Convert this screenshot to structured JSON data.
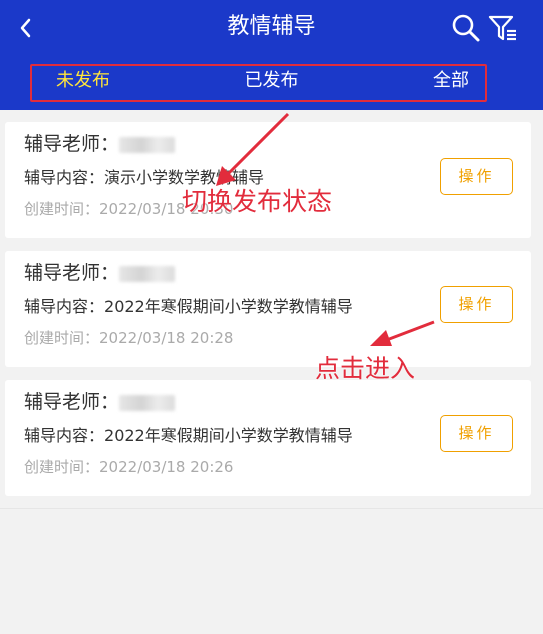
{
  "header": {
    "title": "教情辅导",
    "back_icon": "back-chevron-icon",
    "search_icon": "search-icon",
    "filter_icon": "filter-icon",
    "background": "#1b39c9"
  },
  "tabs": [
    {
      "label": "未发布",
      "active": true
    },
    {
      "label": "已发布",
      "active": false
    },
    {
      "label": "全部",
      "active": false
    }
  ],
  "cards": [
    {
      "teacher_label": "辅导老师：",
      "content_label": "辅导内容：",
      "content_value": "演示小学数学教情辅导",
      "created_label": "创建时间：",
      "created_value": "2022/03/18 20:30",
      "action_label": "操作"
    },
    {
      "teacher_label": "辅导老师：",
      "content_label": "辅导内容：",
      "content_value": "2022年寒假期间小学数学教情辅导",
      "created_label": "创建时间：",
      "created_value": "2022/03/18 20:28",
      "action_label": "操作"
    },
    {
      "teacher_label": "辅导老师：",
      "content_label": "辅导内容：",
      "content_value": "2022年寒假期间小学数学教情辅导",
      "created_label": "创建时间：",
      "created_value": "2022/03/18 20:26",
      "action_label": "操作"
    }
  ],
  "annotations": {
    "switch_status": "切换发布状态",
    "click_enter": "点击进入",
    "color": "#e22c3c"
  },
  "colors": {
    "active_tab": "#ffe53b",
    "action": "#f0a000"
  }
}
